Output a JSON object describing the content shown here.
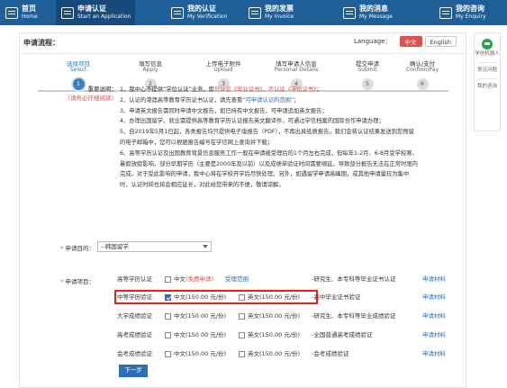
{
  "nav": [
    {
      "zh": "首页",
      "en": "Home",
      "icon": "home-icon"
    },
    {
      "zh": "申请认证",
      "en": "Start an Application",
      "icon": "application-icon",
      "active": true
    },
    {
      "zh": "我的认证",
      "en": "My Verification",
      "icon": "verification-icon"
    },
    {
      "zh": "我的发票",
      "en": "My Invoice",
      "icon": "invoice-icon"
    },
    {
      "zh": "我的消息",
      "en": "My Message",
      "icon": "message-icon"
    },
    {
      "zh": "我的咨询",
      "en": "My Enquiry",
      "icon": "enquiry-icon"
    }
  ],
  "process": {
    "title": "申请流程："
  },
  "language": {
    "label": "Language：",
    "options": [
      "中文",
      "English"
    ],
    "selected": "中文"
  },
  "steps": [
    {
      "zh": "选择项目",
      "en": "Select",
      "num": "1",
      "active": true
    },
    {
      "zh": "填写信息",
      "en": "Apply",
      "num": "2"
    },
    {
      "zh": "上传电子附件",
      "en": "Upload",
      "num": "3"
    },
    {
      "zh": "填写申请人信息",
      "en": "Personal Details",
      "num": "4"
    },
    {
      "zh": "提交申请",
      "en": "Submit",
      "num": "5"
    },
    {
      "zh": "确认/支付",
      "en": "Confirm/Pay",
      "num": "6"
    }
  ],
  "notes": {
    "label": "重要说明：",
    "sublabel": "（请务必仔细阅读）",
    "n1_a": "1、我中心不提供“学位认证”业务，即",
    "n1_b": "只认证《毕业证书》，不认证《学位证书》",
    "n1_c": "；",
    "n2_a": "2、认证的港澳高等教育学历证书认证，请先查看",
    "n2_b": "“可申请认证的范围”",
    "n2_c": "；",
    "n3": "3、申请英文报告需同时申请中文报告，如已持有中文报告，可申请追加英文报告；",
    "n4": "4、办理出国留学、就业需提供高等教育学历认证报告英文翻译件，可通过学信档案的国际合作申请办理；",
    "n5a": "5、自2019年5月1日起，各类报告均只提供电子版报告（PDF），不再出具纸质报告。我们会将认证结果发送到您预留",
    "n5b": "的电子邮箱中，您可以根据报告编号在学信网上查询并下载；",
    "n6a": "6、高等学历认证及出国教育背景信息服务工作一般在申请被受理后的1个月左右完成，但每年1-2月、6-8月受学校寒、",
    "n6b": "暑假放假影响，部分早期学历（主要是2000年及以前）以及成绩单验证时间需要顺延，导致部分报告无法在正常时限内",
    "n6c": "完成。对于受此影响的申请，我中心将在学校开学后尽快处理。另外，如遇留学申请高峰期，或其他申请量较为集中",
    "n6d": "时，认证时间也将会相应延长，对此给您带来的不便，敬请谅解。"
  },
  "purpose": {
    "label": "申请目的：",
    "value": "--韩国留学"
  },
  "items_label": "申请项目：",
  "items": [
    {
      "name": "高等学历认证",
      "cn": "中文",
      "cn_extra": "(免费申请)",
      "link1": "受理范围",
      "desc": "-研究生、本专科等毕业证书认证",
      "material": "申请材料"
    },
    {
      "name": "中等学历验证",
      "cn": "中文(150.00 元/份)",
      "en": "英文(150.00 元/份)",
      "desc": "-高中毕业证书验证",
      "material": "申请材料",
      "cn_checked": true
    },
    {
      "name": "大学成绩验证",
      "cn": "中文(150.00 元/份)",
      "en": "英文(150.00 元/份)",
      "desc": "-研究生、本专科等毕业成绩验证",
      "material": "申请材料"
    },
    {
      "name": "高考成绩验证",
      "cn": "中文(150.00 元/份)",
      "en": "英文(150.00 元/份)",
      "desc": "-全国普通高考成绩验证",
      "material": "申请材料"
    },
    {
      "name": "会考成绩验证",
      "cn": "中文(150.00 元/份)",
      "en": "英文(150.00 元/份)",
      "desc": "-会考成绩验证",
      "material": "申请材料"
    }
  ],
  "next_button": "下一步",
  "side": {
    "robot": "学信机器人",
    "faq": "常见问题",
    "enquiry": "我的咨询"
  },
  "colors": {
    "nav_bg": "#1f5f99",
    "accent": "#3a7fc1",
    "warn": "#d9534f",
    "highlight": "#e0221b"
  }
}
